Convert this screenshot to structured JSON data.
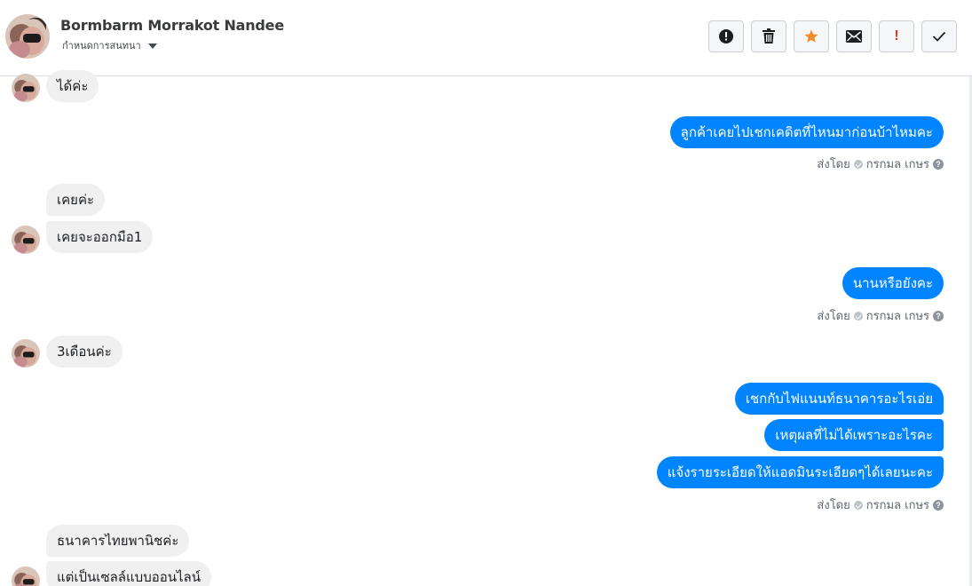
{
  "header": {
    "contact_name": "Bormbarm Morrakot Nandee",
    "subtitle": "กำหนดการสนทนา",
    "toolbar": [
      {
        "name": "report-button",
        "icon": "alert-circle-icon"
      },
      {
        "name": "delete-button",
        "icon": "trash-icon"
      },
      {
        "name": "star-button",
        "icon": "star-icon"
      },
      {
        "name": "mark-unread-button",
        "icon": "envelope-icon"
      },
      {
        "name": "important-button",
        "icon": "exclamation-icon",
        "label": "!"
      },
      {
        "name": "done-button",
        "icon": "checkmark-icon"
      }
    ]
  },
  "thread": {
    "messages": [
      {
        "side": "in",
        "text": "ได้ค่ะ"
      },
      {
        "side": "out",
        "text": "ลูกค้าเคยไปเชกเคดิตที่ไหนมาก่อนบ้าไหมคะ"
      },
      {
        "side": "in",
        "text": "เคยค่ะ"
      },
      {
        "side": "in",
        "text": "เคยจะออกมือ1"
      },
      {
        "side": "out",
        "text": "นานหรือยังคะ"
      },
      {
        "side": "in",
        "text": "3เดือนค่ะ"
      },
      {
        "side": "out",
        "text": "เชกกับไฟแนนท์ธนาคารอะไรเอ่ย"
      },
      {
        "side": "out",
        "text": "เหตุผลที่ไม่ได้เพราะอะไรคะ"
      },
      {
        "side": "out",
        "text": "แจ้งรายระเอียดให้แอดมินระเอียดๆได้เลยนะคะ"
      },
      {
        "side": "in",
        "text": "ธนาคารไทยพานิชค่ะ"
      },
      {
        "side": "in",
        "text": "แต่เป็นเซลล์แบบออนไลน์"
      }
    ],
    "sent_by": {
      "prefix": "ส่งโดย",
      "agent": "กรกมล เกษร",
      "help": "?"
    }
  },
  "colors": {
    "outgoing_bubble": "#0084ff",
    "incoming_bubble": "#f0f0f0",
    "star": "#f28b2c",
    "important": "#e03b1a"
  }
}
